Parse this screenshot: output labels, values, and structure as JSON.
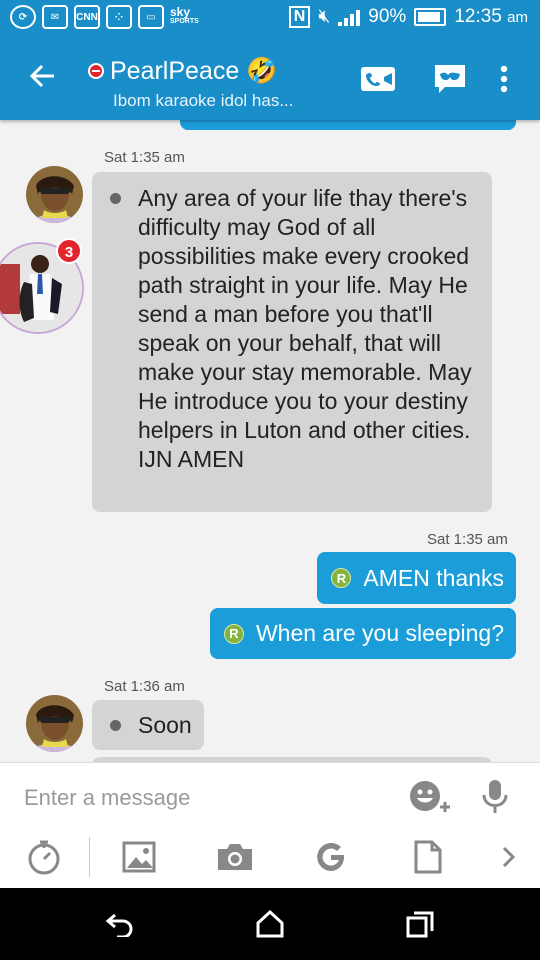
{
  "status_bar": {
    "icons": [
      "sync-icon",
      "mail-icon",
      "cnn-icon",
      "bbm-icon",
      "screenshot-icon",
      "sky-sports-icon",
      "nfc-icon",
      "mute-icon",
      "signal-icon"
    ],
    "cnn_label": "CNN",
    "sky_label": "sky",
    "sky_sub": "SPORTS",
    "battery": "90%",
    "time": "12:35",
    "time_suffix": "am"
  },
  "header": {
    "contact_name": "PearlPeace 🤣",
    "subtitle": "Ibom karaoke idol has...",
    "actions": [
      "video-call-icon",
      "chat-mask-icon",
      "more-options-icon"
    ],
    "badge_count": "3"
  },
  "messages": [
    {
      "direction": "incoming",
      "timestamp": "Sat 1:35 am",
      "text": "Any area of your life thay there's difficulty may God of all possibilities make every crooked path straight in your life. May He send a man before you that'll speak on your behalf, that will make your stay memorable. May He introduce you to your destiny helpers in Luton and other cities. IJN AMEN"
    },
    {
      "direction": "outgoing",
      "timestamp": "Sat 1:35 am",
      "badge": "R",
      "text": "AMEN thanks"
    },
    {
      "direction": "outgoing",
      "badge": "R",
      "text": "When are you sleeping?"
    },
    {
      "direction": "incoming",
      "timestamp": "Sat 1:36 am",
      "text": "Soon"
    }
  ],
  "composer": {
    "placeholder": "Enter a message",
    "tools": [
      "timer-icon",
      "gallery-icon",
      "camera-icon",
      "google-icon",
      "document-icon",
      "chevron-right-icon"
    ]
  },
  "nav": [
    "back-nav-icon",
    "home-nav-icon",
    "recents-nav-icon"
  ],
  "colors": {
    "brand": "#1a8ec8",
    "outgoing_bubble": "#1a9dd9",
    "incoming_bubble": "#d4d4d4",
    "badge_green": "#85b33f",
    "alert_red": "#e3262e"
  }
}
